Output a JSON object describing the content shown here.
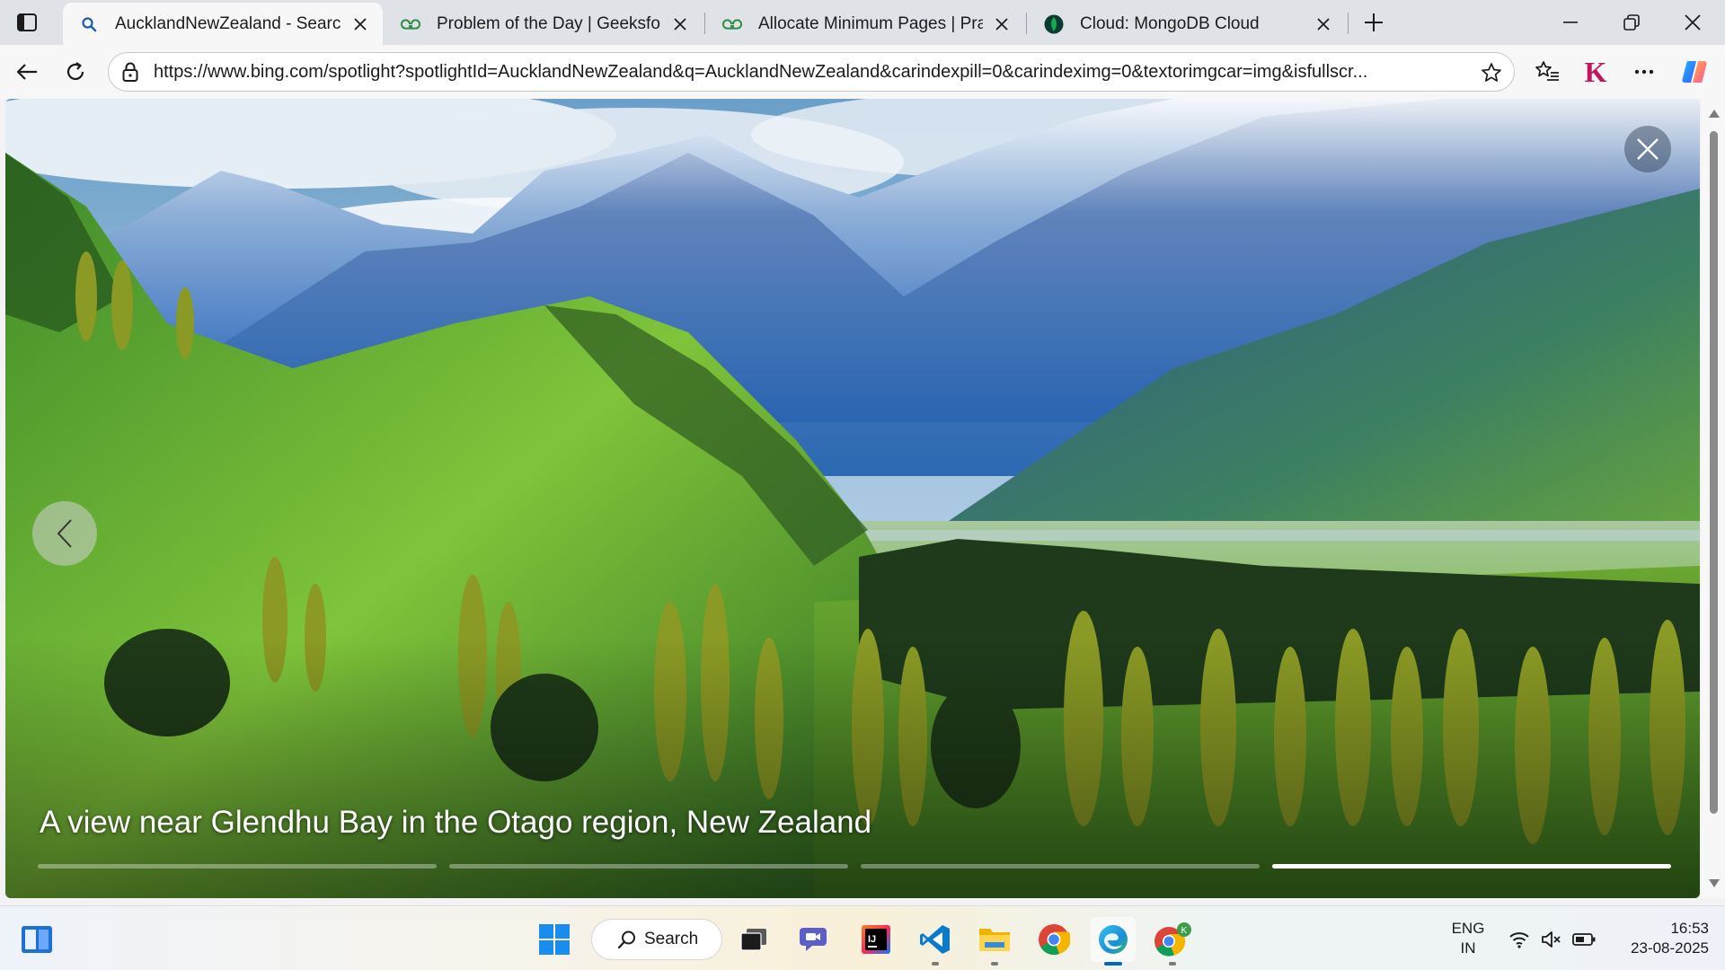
{
  "tabs": [
    {
      "title": "AucklandNewZealand - Search",
      "favicon": "search-icon",
      "active": true
    },
    {
      "title": "Problem of the Day | GeeksforGeeks",
      "favicon": "geeksforgeeks-icon",
      "active": false
    },
    {
      "title": "Allocate Minimum Pages | Practice",
      "favicon": "geeksforgeeks-icon",
      "active": false
    },
    {
      "title": "Cloud: MongoDB Cloud",
      "favicon": "mongodb-leaf-icon",
      "active": false
    }
  ],
  "address_bar": {
    "url": "https://www.bing.com/spotlight?spotlightId=AucklandNewZealand&q=AucklandNewZealand&carindexpill=0&carindeximg=0&textorimgcar=img&isfullscr..."
  },
  "profile": {
    "letter": "K",
    "color": "#c0175d"
  },
  "slideshow": {
    "caption": "A view near Glendhu Bay in the Otago region, New Zealand",
    "slides": [
      {
        "progress": 0
      },
      {
        "progress": 0
      },
      {
        "progress": 0
      },
      {
        "progress": 1
      }
    ]
  },
  "taskbar": {
    "search_label": "Search",
    "apps": [
      {
        "name": "task-view-icon"
      },
      {
        "name": "teams-meet-icon"
      },
      {
        "name": "intellij-idea-icon"
      },
      {
        "name": "vscode-icon"
      },
      {
        "name": "file-explorer-icon"
      },
      {
        "name": "chrome-icon"
      },
      {
        "name": "edge-icon"
      },
      {
        "name": "chrome-profile-icon"
      }
    ],
    "tray": {
      "lang_line1": "ENG",
      "lang_line2": "IN",
      "time": "16:53",
      "date": "23-08-2025"
    }
  },
  "colors": {
    "accent": "#0067c0",
    "edge_profile": "#c0175d",
    "gfg_green": "#2f8d46"
  }
}
